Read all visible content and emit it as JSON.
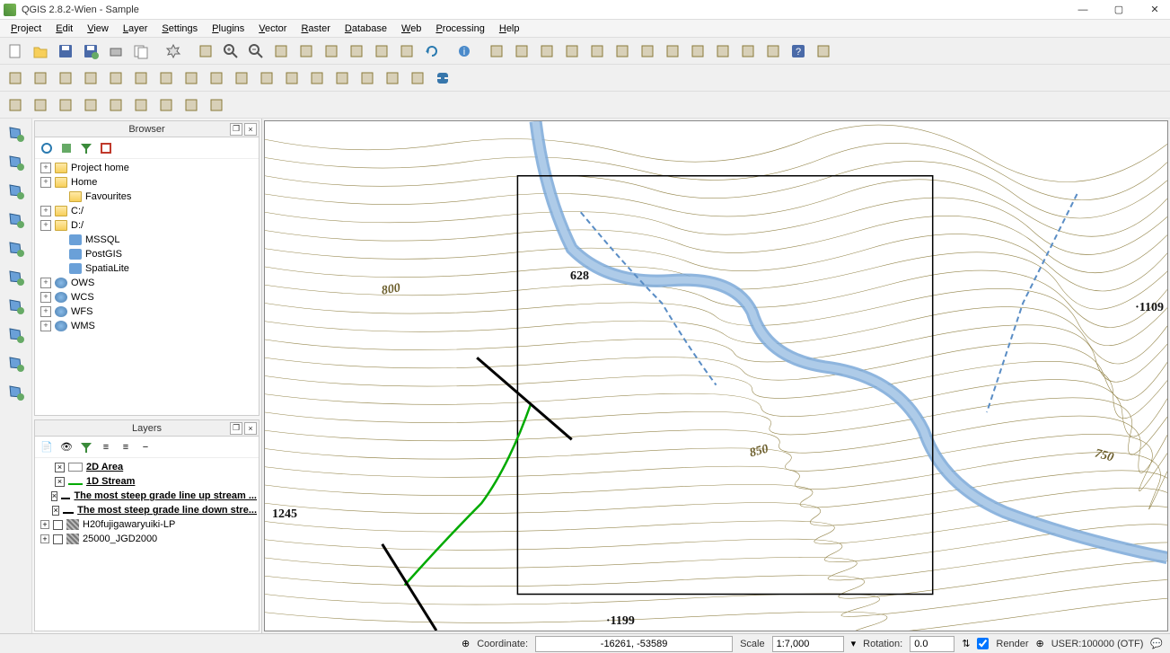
{
  "window": {
    "title": "QGIS 2.8.2-Wien - Sample"
  },
  "menu": {
    "items": [
      "Project",
      "Edit",
      "View",
      "Layer",
      "Settings",
      "Plugins",
      "Vector",
      "Raster",
      "Database",
      "Web",
      "Processing",
      "Help"
    ]
  },
  "toolbar_icons": {
    "row1": [
      "new-project-icon",
      "open-project-icon",
      "save-icon",
      "save-as-icon",
      "print-composer-icon",
      "composer-manager-icon",
      "pan-icon",
      "pan-to-selection-icon",
      "zoom-in-icon",
      "zoom-out-icon",
      "zoom-native-icon",
      "zoom-full-icon",
      "zoom-selection-icon",
      "zoom-layer-icon",
      "zoom-last-icon",
      "zoom-next-icon",
      "refresh-icon",
      "identify-icon",
      "run-feature-action-icon",
      "select-features-icon",
      "deselect-icon",
      "expression-select-icon",
      "sigma-icon",
      "open-table-icon",
      "field-calc-icon",
      "measure-icon",
      "map-tips-icon",
      "text-annotation-icon",
      "bookmarks-icon",
      "text-tool-icon",
      "help-icon",
      "whats-this-icon"
    ],
    "row2": [
      "current-edits-icon",
      "toggle-edit-icon",
      "save-layer-icon",
      "add-feature-icon",
      "move-feature-icon",
      "node-tool-icon",
      "delete-selected-icon",
      "cut-features-icon",
      "copy-features-icon",
      "paste-features-icon",
      "label-abc-icon",
      "label-settings-icon",
      "label-pin-icon",
      "label-show-icon",
      "label-move-icon",
      "label-rotate-icon",
      "label-change-icon",
      "python-console-icon"
    ],
    "row3": [
      "wizard-icon",
      "map-icon",
      "wand-icon",
      "point-icon",
      "rotate-tool-icon",
      "crosshair-icon",
      "rect-select-icon",
      "chart-icon",
      "imagery-icon"
    ]
  },
  "left_tools": [
    "add-vector-icon",
    "add-raster-icon",
    "add-spatialite-icon",
    "add-postgis-icon",
    "add-wms-icon",
    "add-wcs-icon",
    "add-wfs-icon",
    "add-delimited-icon",
    "add-virtual-icon",
    "new-shapefile-icon"
  ],
  "browser": {
    "title": "Browser",
    "items": [
      {
        "exp": "+",
        "icon": "folder",
        "label": "Project home"
      },
      {
        "exp": "+",
        "icon": "folder",
        "label": "Home"
      },
      {
        "exp": " ",
        "icon": "folder",
        "label": "Favourites"
      },
      {
        "exp": "+",
        "icon": "folder",
        "label": "C:/"
      },
      {
        "exp": "+",
        "icon": "folder",
        "label": "D:/"
      },
      {
        "exp": " ",
        "icon": "db",
        "label": "MSSQL"
      },
      {
        "exp": " ",
        "icon": "db",
        "label": "PostGIS"
      },
      {
        "exp": " ",
        "icon": "db",
        "label": "SpatiaLite"
      },
      {
        "exp": "+",
        "icon": "globe",
        "label": "OWS"
      },
      {
        "exp": "+",
        "icon": "globe",
        "label": "WCS"
      },
      {
        "exp": "+",
        "icon": "globe",
        "label": "WFS"
      },
      {
        "exp": "+",
        "icon": "globe",
        "label": "WMS"
      }
    ]
  },
  "layers": {
    "title": "Layers",
    "items": [
      {
        "checked": true,
        "sym": "rect",
        "label": "2D Area",
        "bold": true
      },
      {
        "checked": true,
        "sym": "green",
        "label": "1D Stream",
        "bold": true
      },
      {
        "checked": true,
        "sym": "line",
        "label": "The most steep grade line up stream ...",
        "bold": true
      },
      {
        "checked": true,
        "sym": "line",
        "label": "The most steep grade line down stre...",
        "bold": true
      },
      {
        "checked": false,
        "sym": "raster",
        "label": "H20fujigawaryuiki-LP",
        "bold": false,
        "exp": "+"
      },
      {
        "checked": false,
        "sym": "raster",
        "label": "25000_JGD2000",
        "bold": false,
        "exp": "+"
      }
    ]
  },
  "map_labels": {
    "l1": "628",
    "l2": "·1109",
    "l3": "1245",
    "l4": "·1199",
    "l5": "850",
    "l6": "750",
    "l7": "800"
  },
  "status": {
    "coord_label": "Coordinate:",
    "coord_value": "-16261, -53589",
    "scale_label": "Scale",
    "scale_value": "1:7,000",
    "rotation_label": "Rotation:",
    "rotation_value": "0.0",
    "render_label": "Render",
    "crs_label": "USER:100000 (OTF)"
  }
}
